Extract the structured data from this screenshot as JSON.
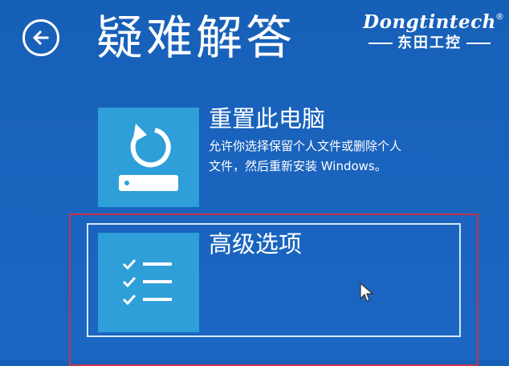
{
  "header": {
    "back_icon": "arrow-left-icon",
    "title": "疑难解答"
  },
  "watermark": {
    "brand": "Dongtintech",
    "registered": "®",
    "subtitle": "东田工控"
  },
  "options": [
    {
      "icon": "reset-pc-icon",
      "title": "重置此电脑",
      "description_line1": "允许你选择保留个人文件或删除个人",
      "description_line2": "文件，然后重新安装 Windows。"
    },
    {
      "icon": "checklist-icon",
      "title": "高级选项"
    }
  ],
  "colors": {
    "background": "#1a63bd",
    "tile": "#2e9fd8",
    "highlight": "#c4334a",
    "text": "#ffffff"
  }
}
